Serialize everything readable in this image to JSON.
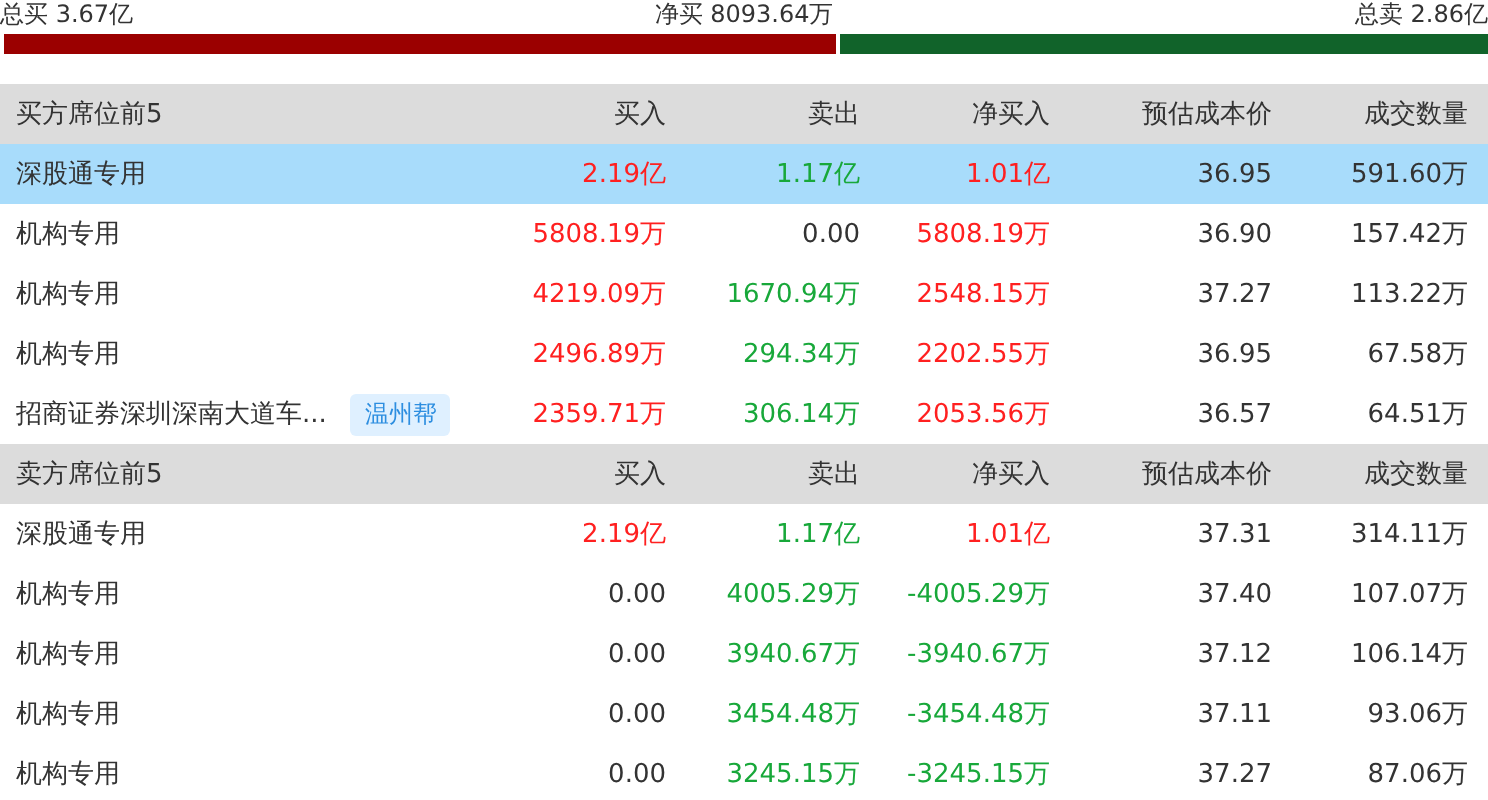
{
  "summary": {
    "total_buy": "总买 3.67亿",
    "net_buy": "净买 8093.64万",
    "total_sell": "总卖 2.86亿",
    "level": 0.56
  },
  "sections": [
    {
      "columns": [
        "买方席位前5",
        "买入",
        "卖出",
        "净买入",
        "预估成本价",
        "成交数量"
      ],
      "rows": [
        {
          "selected": true,
          "cells": [
            {
              "text": "深股通专用"
            },
            {
              "text": "2.19亿",
              "color": "#ff2020"
            },
            {
              "text": "1.17亿",
              "color": "#18a83a"
            },
            {
              "text": "1.01亿",
              "color": "#ff2020"
            },
            {
              "text": "36.95"
            },
            {
              "text": "591.60万"
            }
          ]
        },
        {
          "selected": false,
          "cells": [
            {
              "text": "机构专用"
            },
            {
              "text": "5808.19万",
              "color": "#ff2020"
            },
            {
              "text": "0.00"
            },
            {
              "text": "5808.19万",
              "color": "#ff2020"
            },
            {
              "text": "36.90"
            },
            {
              "text": "157.42万"
            }
          ]
        },
        {
          "selected": false,
          "cells": [
            {
              "text": "机构专用"
            },
            {
              "text": "4219.09万",
              "color": "#ff2020"
            },
            {
              "text": "1670.94万",
              "color": "#18a83a"
            },
            {
              "text": "2548.15万",
              "color": "#ff2020"
            },
            {
              "text": "37.27"
            },
            {
              "text": "113.22万"
            }
          ]
        },
        {
          "selected": false,
          "cells": [
            {
              "text": "机构专用"
            },
            {
              "text": "2496.89万",
              "color": "#ff2020"
            },
            {
              "text": "294.34万",
              "color": "#18a83a"
            },
            {
              "text": "2202.55万",
              "color": "#ff2020"
            },
            {
              "text": "36.95"
            },
            {
              "text": "67.58万"
            }
          ]
        },
        {
          "selected": false,
          "tag": "温州帮",
          "cells": [
            {
              "text": "招商证券深圳深南大道车..."
            },
            {
              "text": "2359.71万",
              "color": "#ff2020"
            },
            {
              "text": "306.14万",
              "color": "#18a83a"
            },
            {
              "text": "2053.56万",
              "color": "#ff2020"
            },
            {
              "text": "36.57"
            },
            {
              "text": "64.51万"
            }
          ]
        }
      ]
    },
    {
      "columns": [
        "卖方席位前5",
        "买入",
        "卖出",
        "净买入",
        "预估成本价",
        "成交数量"
      ],
      "rows": [
        {
          "selected": false,
          "cells": [
            {
              "text": "深股通专用"
            },
            {
              "text": "2.19亿",
              "color": "#ff2020"
            },
            {
              "text": "1.17亿",
              "color": "#18a83a"
            },
            {
              "text": "1.01亿",
              "color": "#ff2020"
            },
            {
              "text": "37.31"
            },
            {
              "text": "314.11万"
            }
          ]
        },
        {
          "selected": false,
          "cells": [
            {
              "text": "机构专用"
            },
            {
              "text": "0.00"
            },
            {
              "text": "4005.29万",
              "color": "#18a83a"
            },
            {
              "text": "-4005.29万",
              "color": "#18a83a"
            },
            {
              "text": "37.40"
            },
            {
              "text": "107.07万"
            }
          ]
        },
        {
          "selected": false,
          "cells": [
            {
              "text": "机构专用"
            },
            {
              "text": "0.00"
            },
            {
              "text": "3940.67万",
              "color": "#18a83a"
            },
            {
              "text": "-3940.67万",
              "color": "#18a83a"
            },
            {
              "text": "37.12"
            },
            {
              "text": "106.14万"
            }
          ]
        },
        {
          "selected": false,
          "cells": [
            {
              "text": "机构专用"
            },
            {
              "text": "0.00"
            },
            {
              "text": "3454.48万",
              "color": "#18a83a"
            },
            {
              "text": "-3454.48万",
              "color": "#18a83a"
            },
            {
              "text": "37.11"
            },
            {
              "text": "93.06万"
            }
          ]
        },
        {
          "selected": false,
          "cells": [
            {
              "text": "机构专用"
            },
            {
              "text": "0.00"
            },
            {
              "text": "3245.15万",
              "color": "#18a83a"
            },
            {
              "text": "-3245.15万",
              "color": "#18a83a"
            },
            {
              "text": "37.27"
            },
            {
              "text": "87.06万"
            }
          ]
        }
      ]
    }
  ]
}
